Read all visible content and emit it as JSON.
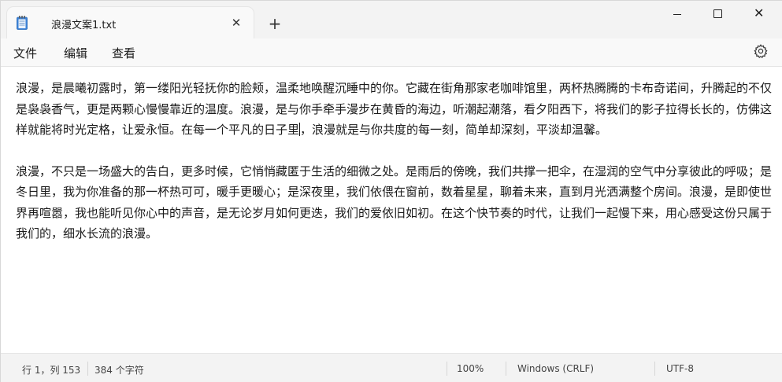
{
  "tab": {
    "title": "浪漫文案1.txt",
    "close_label": "✕",
    "new_tab_label": "+"
  },
  "window_controls": {
    "minimize": "minimize",
    "maximize": "maximize",
    "close": "✕"
  },
  "menu": {
    "file": "文件",
    "edit": "编辑",
    "view": "查看"
  },
  "editor": {
    "paragraph1_before_caret": "浪漫，是晨曦初露时，第一缕阳光轻抚你的脸颊，温柔地唤醒沉睡中的你。它藏在街角那家老咖啡馆里，两杯热腾腾的卡布奇诺间，升腾起的不仅是袅袅香气，更是两颗心慢慢靠近的温度。浪漫，是与你手牵手漫步在黄昏的海边，听潮起潮落，看夕阳西下，将我们的影子拉得长长的，仿佛这样就能将时光定格，让爱永恒。在每一个平凡的日子里",
    "paragraph1_after_caret": "，浪漫就是与你共度的每一刻，简单却深刻，平淡却温馨。",
    "paragraph2": "浪漫，不只是一场盛大的告白，更多时候，它悄悄藏匿于生活的细微之处。是雨后的傍晚，我们共撑一把伞，在湿润的空气中分享彼此的呼吸；是冬日里，我为你准备的那一杯热可可，暖手更暖心；是深夜里，我们依偎在窗前，数着星星，聊着未来，直到月光洒满整个房间。浪漫，是即使世界再喧嚣，我也能听见你心中的声音，是无论岁月如何更迭，我们的爱依旧如初。在这个快节奏的时代，让我们一起慢下来，用心感受这份只属于我们的，细水长流的浪漫。"
  },
  "status": {
    "position": "行 1，列 153",
    "char_count": "384 个字符",
    "zoom": "100%",
    "line_ending": "Windows (CRLF)",
    "encoding": "UTF-8"
  },
  "icons": {
    "app": "notepad-icon",
    "settings": "gear-icon"
  },
  "colors": {
    "titlebar": "#f3f3f3",
    "menubar": "#f9f9f9",
    "statusbar": "#f3f3f3",
    "text": "#1a1a1a"
  }
}
